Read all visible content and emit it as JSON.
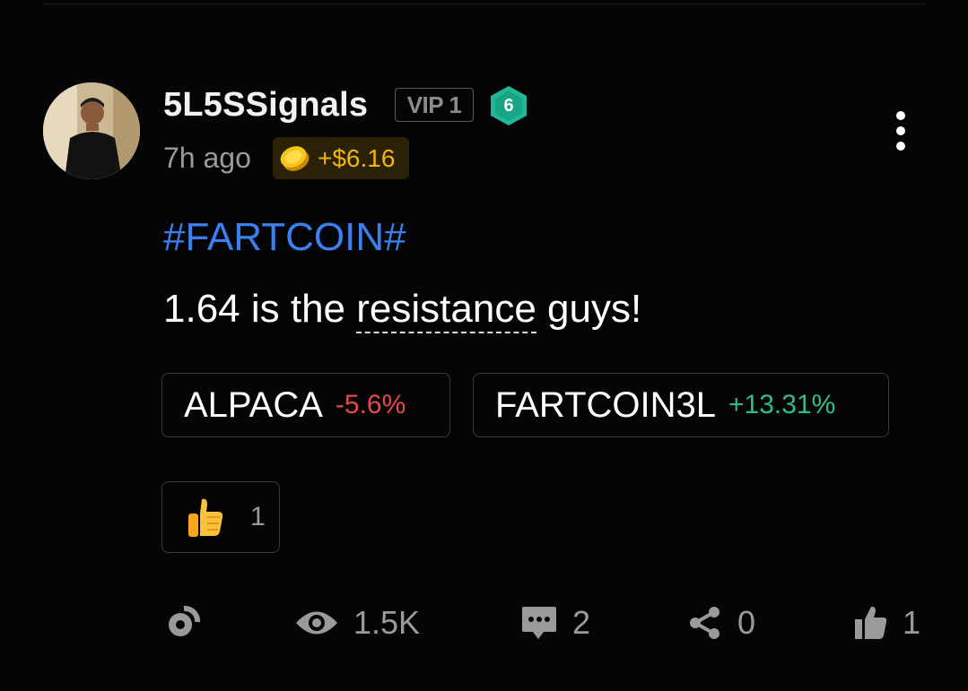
{
  "post": {
    "author": "5L5SSignals",
    "vip_label": "VIP 1",
    "level": "6",
    "time_ago": "7h ago",
    "tip_amount": "+$6.16",
    "hashtag": "#FARTCOIN#",
    "text_before": "1.64 is the ",
    "text_term": "resistance",
    "text_after": " guys!"
  },
  "tickers": [
    {
      "symbol": "ALPACA",
      "change": "-5.6%",
      "direction": "down"
    },
    {
      "symbol": "FARTCOIN3L",
      "change": "+13.31%",
      "direction": "up"
    }
  ],
  "reaction": {
    "emoji": "thumbs-up",
    "count": "1"
  },
  "footer": {
    "views": "1.5K",
    "comments": "2",
    "shares": "0",
    "likes": "1"
  },
  "colors": {
    "background": "#050505",
    "hashtag": "#3b7ff0",
    "negative": "#e5484d",
    "positive": "#2ebd85",
    "tip": "#f0b30f",
    "level_badge": "#1fb89a"
  },
  "icons": [
    "more-vertical-icon",
    "coin-icon",
    "level-hexagon-icon",
    "repost-icon",
    "eye-icon",
    "comment-icon",
    "share-icon",
    "like-icon"
  ]
}
